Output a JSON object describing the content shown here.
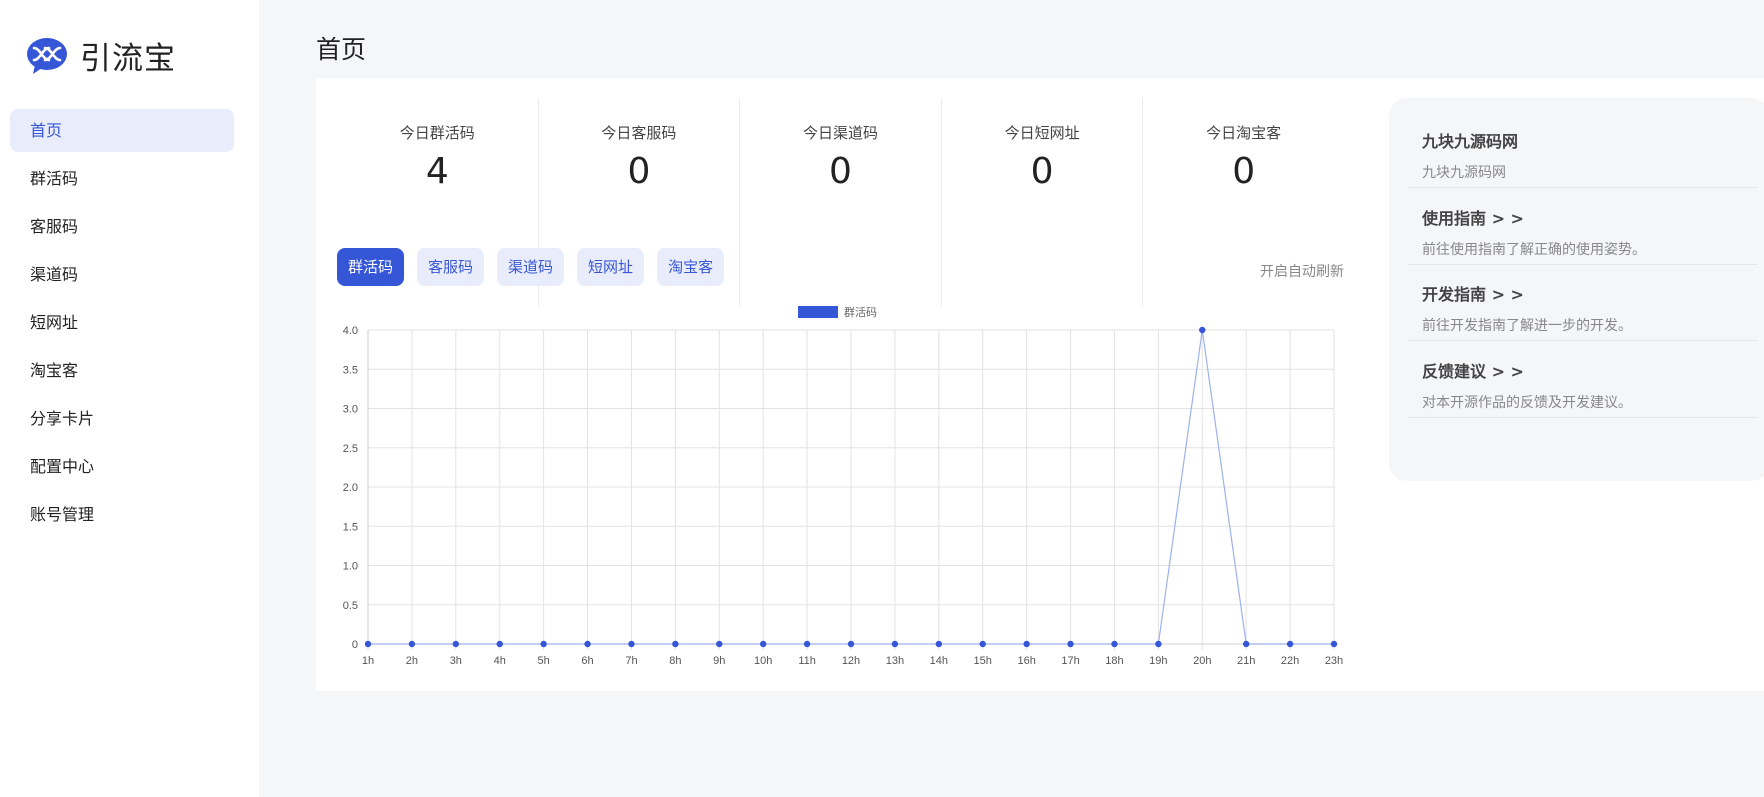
{
  "app": {
    "name": "引流宝"
  },
  "page": {
    "title": "首页"
  },
  "sidebar": {
    "items": [
      {
        "label": "首页",
        "active": true
      },
      {
        "label": "群活码"
      },
      {
        "label": "客服码"
      },
      {
        "label": "渠道码"
      },
      {
        "label": "短网址"
      },
      {
        "label": "淘宝客"
      },
      {
        "label": "分享卡片"
      },
      {
        "label": "配置中心"
      },
      {
        "label": "账号管理"
      }
    ]
  },
  "stats": [
    {
      "label": "今日群活码",
      "value": "4"
    },
    {
      "label": "今日客服码",
      "value": "0"
    },
    {
      "label": "今日渠道码",
      "value": "0"
    },
    {
      "label": "今日短网址",
      "value": "0"
    },
    {
      "label": "今日淘宝客",
      "value": "0"
    }
  ],
  "tabs": [
    {
      "label": "群活码",
      "active": true
    },
    {
      "label": "客服码"
    },
    {
      "label": "渠道码"
    },
    {
      "label": "短网址"
    },
    {
      "label": "淘宝客"
    }
  ],
  "auto_refresh_label": "开启自动刷新",
  "guides": [
    {
      "title": "九块九源码网",
      "desc": "九块九源码网"
    },
    {
      "title": "使用指南 > >",
      "desc": "前往使用指南了解正确的使用姿势。"
    },
    {
      "title": "开发指南 > >",
      "desc": "前往开发指南了解进一步的开发。"
    },
    {
      "title": "反馈建议 > >",
      "desc": "对本开源作品的反馈及开发建议。"
    }
  ],
  "colors": {
    "accent": "#3556d6",
    "line": "#9db1ec"
  },
  "chart_data": {
    "type": "line",
    "categories": [
      "1h",
      "2h",
      "3h",
      "4h",
      "5h",
      "6h",
      "7h",
      "8h",
      "9h",
      "10h",
      "11h",
      "12h",
      "13h",
      "14h",
      "15h",
      "16h",
      "17h",
      "18h",
      "19h",
      "20h",
      "21h",
      "22h",
      "23h"
    ],
    "series": [
      {
        "name": "群活码",
        "values": [
          0,
          0,
          0,
          0,
          0,
          0,
          0,
          0,
          0,
          0,
          0,
          0,
          0,
          0,
          0,
          0,
          0,
          0,
          0,
          4,
          0,
          0,
          0
        ]
      }
    ],
    "yticks": [
      "0",
      "0.5",
      "1.0",
      "1.5",
      "2.0",
      "2.5",
      "3.0",
      "3.5",
      "4.0"
    ],
    "ylim": [
      0,
      4
    ],
    "grid": true,
    "legend": "top-center"
  }
}
